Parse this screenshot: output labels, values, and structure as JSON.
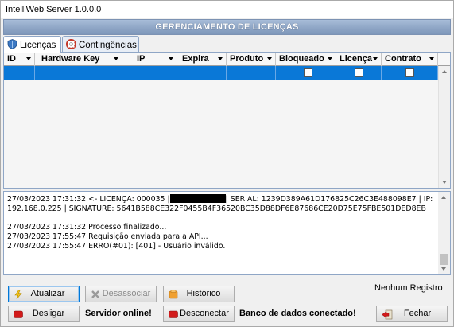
{
  "window": {
    "title": "IntelliWeb Server 1.0.0.0"
  },
  "header": {
    "title": "GERENCIAMENTO DE LICENÇAS"
  },
  "tabs": [
    {
      "label": "Licenças",
      "icon": "shield-icon",
      "active": true
    },
    {
      "label": "Contingências",
      "icon": "lifebuoy-icon",
      "active": false
    }
  ],
  "grid": {
    "columns": [
      "ID",
      "Hardware Key",
      "IP",
      "Expira",
      "Produto",
      "Bloqueado",
      "Licença",
      "Contrato"
    ],
    "rows": [
      {
        "id": "",
        "hardware_key": "",
        "ip": "",
        "expira": "",
        "produto": "",
        "bloqueado": false,
        "licenca": false,
        "contrato": false
      }
    ]
  },
  "log": {
    "lines": [
      "27/03/2023 17:31:32 <- LICENÇA: 000035 |",
      "| SERIAL: 1239D389A61D176825C26C3E488098E7 | IP:",
      "192.168.0.225 | SIGNATURE: 5641B588CE322F0455B4F36520BC35D88DF6E87686CE20D75E75FBE501DED8EB",
      "27/03/2023 17:31:32 Processo finalizado...",
      "27/03/2023 17:55:47 Requisição enviada para a API...",
      "27/03/2023 17:55:47 ERRO(#01): [401] - Usuário inválido."
    ]
  },
  "footer": {
    "atualizar": "Atualizar",
    "desassociar": "Desassociar",
    "historico": "Histórico",
    "registro_status": "Nenhum Registro",
    "desligar": "Desligar",
    "servidor_status": "Servidor online!",
    "desconectar": "Desconectar",
    "banco_status": "Banco de dados conectado!",
    "fechar": "Fechar"
  },
  "colors": {
    "header": "#8fa6c6",
    "selection": "#0a78d7",
    "stop_red": "#d21a1a",
    "history_orange": "#f0a030"
  }
}
